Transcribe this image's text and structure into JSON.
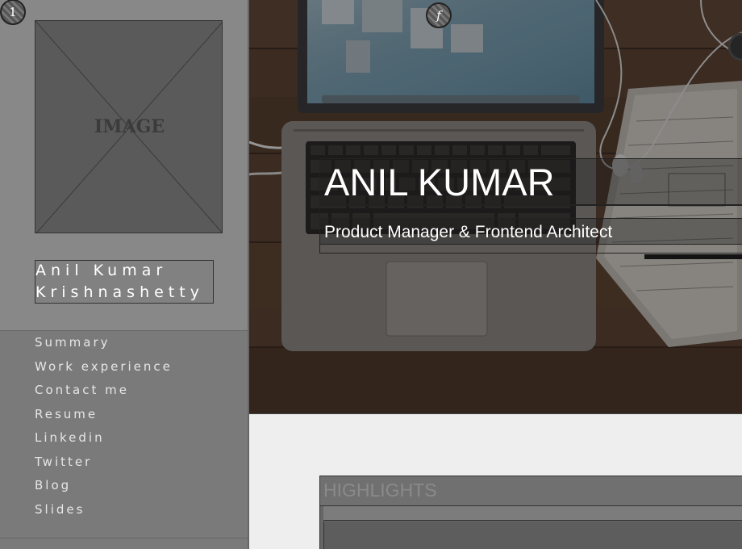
{
  "badges": {
    "number": "1",
    "facebook": "f"
  },
  "sidebar": {
    "image_label": "IMAGE",
    "name_line1": "Anil Kumar",
    "name_line2": "Krishnashetty",
    "nav": [
      "Summary",
      "Work experience",
      "Contact me",
      "Resume",
      "Linkedin",
      "Twitter",
      "Blog",
      "Slides"
    ]
  },
  "hero": {
    "title": "ANIL KUMAR",
    "subtitle": "Product Manager & Frontend Architect"
  },
  "highlights": {
    "title": "HIGHLIGHTS"
  }
}
